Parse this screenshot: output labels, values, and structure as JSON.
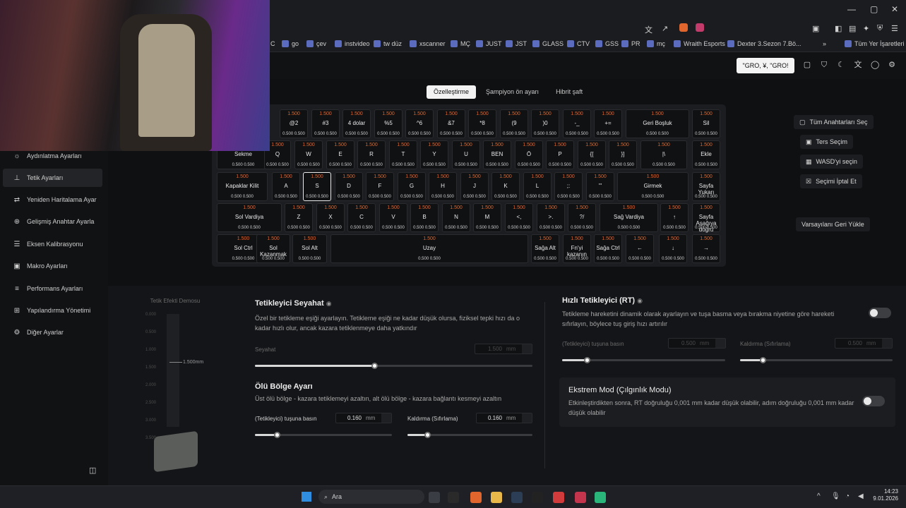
{
  "browser": {
    "bookmarks": [
      {
        "label": "C"
      },
      {
        "label": "go"
      },
      {
        "label": "çev"
      },
      {
        "label": "instvideo"
      },
      {
        "label": "tw düz"
      },
      {
        "label": "xscanner"
      },
      {
        "label": "MÇ"
      },
      {
        "label": "JUST"
      },
      {
        "label": "JST"
      },
      {
        "label": "GLASS"
      },
      {
        "label": "CTV"
      },
      {
        "label": "GSS"
      },
      {
        "label": "PR"
      },
      {
        "label": "mç"
      },
      {
        "label": "Wraith Esports"
      },
      {
        "label": "Dexter 3.Sezon 7.Bö..."
      },
      {
        "label": "Tüm Yer İşaretleri"
      }
    ],
    "more_label": "»"
  },
  "header": {
    "tabs": [
      "Özelleştirme",
      "Şampiyon ön ayarı",
      "Hibrit şaft"
    ],
    "active_tab": 0,
    "search_button": "\"GRO, ¥, \"GRO!"
  },
  "sidebar": {
    "items": [
      {
        "label": "Aydınlatma Ayarları",
        "icon": "sun-icon"
      },
      {
        "label": "Tetik Ayarları",
        "icon": "trigger-icon"
      },
      {
        "label": "Yeniden Haritalama Ayar",
        "icon": "remap-icon"
      },
      {
        "label": "Gelişmiş Anahtar Ayarla",
        "icon": "advanced-key-icon"
      },
      {
        "label": "Eksen Kalibrasyonu",
        "icon": "axis-icon"
      },
      {
        "label": "Makro Ayarları",
        "icon": "macro-icon"
      },
      {
        "label": "Performans Ayarları",
        "icon": "performance-icon"
      },
      {
        "label": "Yapılandırma Yönetimi",
        "icon": "config-icon"
      },
      {
        "label": "Diğer Ayarlar",
        "icon": "gear-icon"
      }
    ],
    "active": 1
  },
  "keyboard": {
    "rows": [
      [
        {
          "n": "@2",
          "t": "1.500",
          "b": "0.500 0.500"
        },
        {
          "n": "#3",
          "t": "1.500",
          "b": "0.500 0.500"
        },
        {
          "n": "4 dolar",
          "t": "1.500",
          "b": "0.500 0.500"
        },
        {
          "n": "%5",
          "t": "1.500",
          "b": "0.500 0.500"
        },
        {
          "n": "^6",
          "t": "1.500",
          "b": "0.500 0.500"
        },
        {
          "n": "&7",
          "t": "1.500",
          "b": "0.500 0.500"
        },
        {
          "n": "*8",
          "t": "1.500",
          "b": "0.500 0.500"
        },
        {
          "n": "(9",
          "t": "1.500",
          "b": "0.500 0.500"
        },
        {
          "n": ")0",
          "t": "1.500",
          "b": "0.500 0.500"
        },
        {
          "n": "-_",
          "t": "1.500",
          "b": "0.500 0.500"
        },
        {
          "n": "+=",
          "t": "1.500",
          "b": "0.500 0.500"
        },
        {
          "n": "Geri Boşluk",
          "t": "1.500",
          "b": "0.500 0.500"
        },
        {
          "n": "Sil",
          "t": "1.500",
          "b": "0.500 0.500"
        }
      ],
      [
        {
          "n": "Sekme",
          "t": "",
          "b": "0.500 0.500"
        },
        {
          "n": "Q",
          "t": "1.500",
          "b": "0.500 0.500"
        },
        {
          "n": "W",
          "t": "1.500",
          "b": "0.500 0.500"
        },
        {
          "n": "E",
          "t": "1.500",
          "b": "0.500 0.500"
        },
        {
          "n": "R",
          "t": "1.500",
          "b": "0.500 0.500"
        },
        {
          "n": "T",
          "t": "1.500",
          "b": "0.500 0.500"
        },
        {
          "n": "Y",
          "t": "1.500",
          "b": "0.500 0.500"
        },
        {
          "n": "U",
          "t": "1.500",
          "b": "0.500 0.500"
        },
        {
          "n": "BEN",
          "t": "1.500",
          "b": "0.500 0.500"
        },
        {
          "n": "Ö",
          "t": "1.500",
          "b": "0.500 0.500"
        },
        {
          "n": "P",
          "t": "1.500",
          "b": "0.500 0.500"
        },
        {
          "n": "{[",
          "t": "1.500",
          "b": "0.500 0.500"
        },
        {
          "n": "}]",
          "t": "1.500",
          "b": "0.500 0.500"
        },
        {
          "n": "|\\",
          "t": "1.500",
          "b": "0.500 0.500"
        },
        {
          "n": "Ekle",
          "t": "1.500",
          "b": "0.500 0.500"
        }
      ],
      [
        {
          "n": "Kapaklar Kilit",
          "t": "1.500",
          "b": "0.500 0.500"
        },
        {
          "n": "A",
          "t": "1.500",
          "b": "0.500 0.500"
        },
        {
          "n": "S",
          "t": "1.500",
          "b": "0.500 0.500"
        },
        {
          "n": "D",
          "t": "1.500",
          "b": "0.500 0.500"
        },
        {
          "n": "F",
          "t": "1.500",
          "b": "0.500 0.500"
        },
        {
          "n": "G",
          "t": "1.500",
          "b": "0.500 0.500"
        },
        {
          "n": "H",
          "t": "1.500",
          "b": "0.500 0.500"
        },
        {
          "n": "J",
          "t": "1.500",
          "b": "0.500 0.500"
        },
        {
          "n": "K",
          "t": "1.500",
          "b": "0.500 0.500"
        },
        {
          "n": "L",
          "t": "1.500",
          "b": "0.500 0.500"
        },
        {
          "n": ";:",
          "t": "1.500",
          "b": "0.500 0.500"
        },
        {
          "n": "'\"",
          "t": "1.500",
          "b": "0.500 0.500"
        },
        {
          "n": "Girmek",
          "t": "1.500",
          "b": "0.500 0.500"
        },
        {
          "n": "Sayfa Yukarı",
          "t": "1.500",
          "b": "0.500 0.500"
        }
      ],
      [
        {
          "n": "Sol Vardiya",
          "t": "1.500",
          "b": "0.500 0.500"
        },
        {
          "n": "Z",
          "t": "1.500",
          "b": "0.500 0.500"
        },
        {
          "n": "X",
          "t": "1.500",
          "b": "0.500 0.500"
        },
        {
          "n": "C",
          "t": "1.500",
          "b": "0.500 0.500"
        },
        {
          "n": "V",
          "t": "1.500",
          "b": "0.500 0.500"
        },
        {
          "n": "B",
          "t": "1.500",
          "b": "0.500 0.500"
        },
        {
          "n": "N",
          "t": "1.500",
          "b": "0.500 0.500"
        },
        {
          "n": "M",
          "t": "1.500",
          "b": "0.500 0.500"
        },
        {
          "n": "<,",
          "t": "1.500",
          "b": "0.500 0.500"
        },
        {
          "n": ">.",
          "t": "1.500",
          "b": "0.500 0.500"
        },
        {
          "n": "?/",
          "t": "1.500",
          "b": "0.500 0.500"
        },
        {
          "n": "Sağ Vardiya",
          "t": "1.500",
          "b": "0.500 0.500"
        },
        {
          "n": "↑",
          "t": "1.500",
          "b": "0.500 0.500"
        },
        {
          "n": "Sayfa Aşağıya doğru",
          "t": "1.500",
          "b": "0.500 0.500"
        }
      ],
      [
        {
          "n": "Sol Ctrl",
          "t": "1.500",
          "b": "0.500 0.500"
        },
        {
          "n": "Sol Kazanmak",
          "t": "1.500",
          "b": "0.500 0.500"
        },
        {
          "n": "Sol Alt",
          "t": "1.500",
          "b": "0.500 0.500"
        },
        {
          "n": "Uzay",
          "t": "1.500",
          "b": "0.500 0.500"
        },
        {
          "n": "Sağa Alt",
          "t": "1.500",
          "b": "0.500 0.500"
        },
        {
          "n": "Fn'yi kazanın",
          "t": "1.500",
          "b": "0.500 0.500"
        },
        {
          "n": "Sağa Ctrl",
          "t": "1.500",
          "b": "0.500 0.500"
        },
        {
          "n": "←",
          "t": "1.500",
          "b": "0.500 0.500"
        },
        {
          "n": "↓",
          "t": "1.500",
          "b": "0.500 0.500"
        },
        {
          "n": "→",
          "t": "1.500",
          "b": "0.500 0.500"
        }
      ]
    ]
  },
  "right_buttons": [
    {
      "label": "Tüm Anahtarları Seç",
      "icon": "select-all-icon"
    },
    {
      "label": "Ters Seçim",
      "icon": "invert-icon"
    },
    {
      "label": "WASD'yi seçin",
      "icon": "wasd-icon"
    },
    {
      "label": "Seçimi İptal Et",
      "icon": "cancel-selection-icon"
    }
  ],
  "reset_button": "Varsayılanı Geri Yükle",
  "demo": {
    "title": "Tetik Efekti Demosu",
    "scale": [
      "0.000",
      "0.500",
      "1.000",
      "1.500",
      "2.000",
      "2.500",
      "3.000",
      "3.500"
    ],
    "marker": "1.500mm"
  },
  "travel": {
    "title": "Tetikleyici Seyahat",
    "desc": "Özel bir tetikleme eşiği ayarlayın. Tetikleme eşiği ne kadar düşük olursa, fiziksel tepki hızı da o kadar hızlı olur, ancak kazara tetiklenmeye daha yatkındır",
    "label": "Seyahat",
    "value": "1.500",
    "unit": "mm",
    "fraction": 0.43
  },
  "deadzone": {
    "title": "Ölü Bölge Ayarı",
    "desc": "Üst ölü bölge - kazara tetiklemeyi azaltın, alt ölü bölge - kazara bağlantı kesmeyi azaltın",
    "press_label": "(Tetikleyici) tuşuna basın",
    "press_value": "0.160",
    "release_label": "Kaldırma (Sıfırlama)",
    "release_value": "0.160",
    "unit": "mm",
    "press_fraction": 0.16,
    "release_fraction": 0.16
  },
  "rt": {
    "title": "Hızlı Tetikleyici (RT)",
    "desc": "Tetikleme hareketini dinamik olarak ayarlayın ve tuşa basma veya bırakma niyetine göre hareketi sıfırlayın, böylece tuş giriş hızı artırılır",
    "press_label": "(Tetikleyici) tuşuna basın",
    "press_value": "0.500",
    "release_label": "Kaldırma (Sıfırlama)",
    "release_value": "0.500",
    "unit": "mm",
    "enabled": false,
    "press_fraction": 0.15,
    "release_fraction": 0.15
  },
  "extreme": {
    "title": "Ekstrem Mod (Çılgınlık Modu)",
    "desc": "Etkinleştirdikten sonra, RT doğruluğu 0,001 mm kadar düşük olabilir, adım doğruluğu 0,001 mm kadar düşük olabilir",
    "enabled": false
  },
  "taskbar": {
    "search": "Ara",
    "time": "14:23",
    "date": "9.01.2026"
  },
  "colors": {
    "accent": "#e0662d",
    "key_bg": "#101113",
    "panel": "#1c1d20"
  }
}
